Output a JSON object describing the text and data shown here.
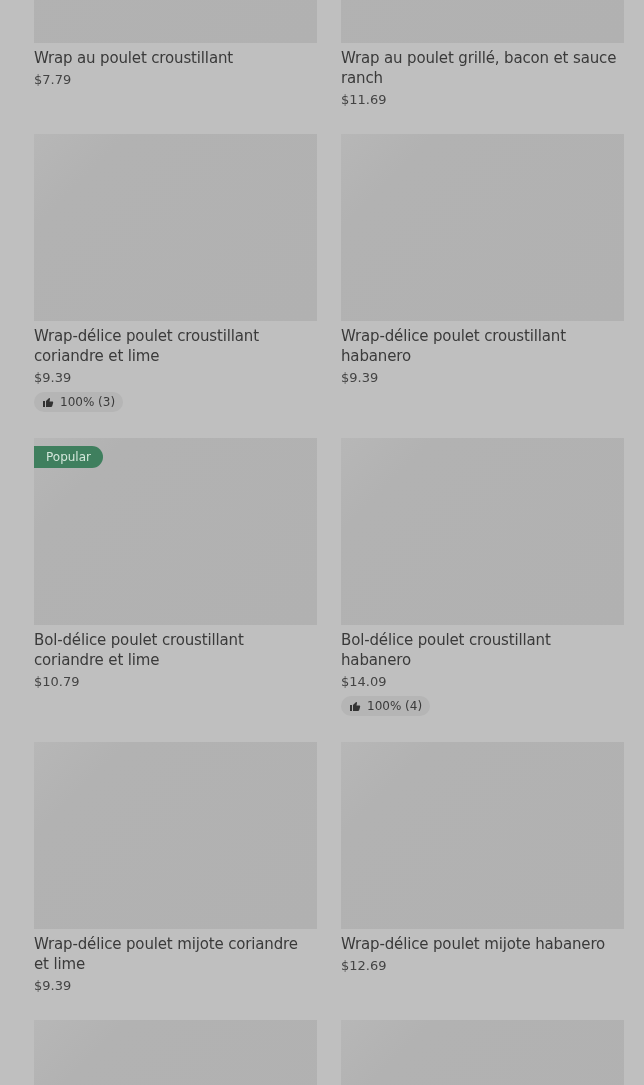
{
  "items": [
    {
      "kind": "item",
      "name": "Wrap au poulet croustillant",
      "price": "$7.79"
    },
    {
      "kind": "item",
      "name": "Wrap au poulet grillé, bacon et sauce ranch",
      "price": "$11.69"
    },
    {
      "kind": "item",
      "name": "Wrap-délice poulet croustillant coriandre et lime",
      "price": "$9.39",
      "rating": "100% (3)"
    },
    {
      "kind": "item",
      "name": "Wrap-délice poulet croustillant habanero",
      "price": "$9.39"
    },
    {
      "kind": "item",
      "name": "Bol-délice poulet croustillant coriandre et lime",
      "price": "$10.79",
      "badge": "Popular"
    },
    {
      "kind": "item",
      "name": "Bol-délice poulet croustillant habanero",
      "price": "$14.09",
      "rating": "100% (4)"
    },
    {
      "kind": "item",
      "name": "Wrap-délice poulet mijote coriandre et lime",
      "price": "$9.39"
    },
    {
      "kind": "item",
      "name": "Wrap-délice poulet mijote habanero",
      "price": "$12.69"
    },
    {
      "kind": "image_only"
    },
    {
      "kind": "image_only"
    }
  ]
}
